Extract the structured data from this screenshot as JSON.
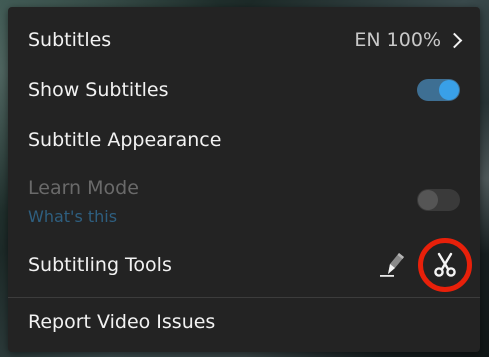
{
  "menu": {
    "subtitles": {
      "label": "Subtitles",
      "value": "EN 100%",
      "icon": "chevron-right-icon"
    },
    "show_subtitles": {
      "label": "Show Subtitles",
      "enabled": true
    },
    "subtitle_appearance": {
      "label": "Subtitle Appearance"
    },
    "learn_mode": {
      "label": "Learn Mode",
      "link": "What's this",
      "enabled": false,
      "disabled": true
    },
    "subtitling_tools": {
      "label": "Subtitling Tools",
      "icons": [
        "pencil-edit-icon",
        "scissors-icon"
      ],
      "highlight_color": "#e8200a"
    },
    "report": {
      "label": "Report Video Issues"
    }
  },
  "colors": {
    "menu_bg": "#232323",
    "toggle_on": "#39a0e8",
    "link_color": "#2e5f80",
    "disabled_text": "#6a6a6a"
  }
}
